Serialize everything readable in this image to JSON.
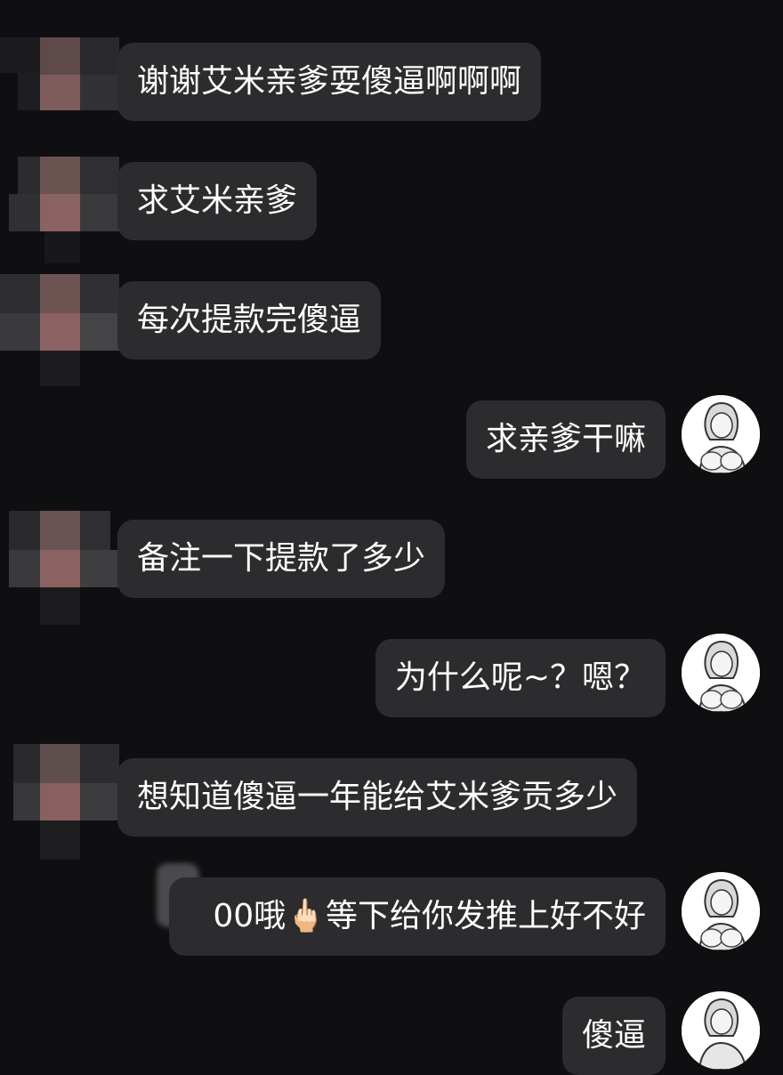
{
  "messages": [
    {
      "side": "in",
      "text": "谢谢艾米亲爹耍傻逼啊啊啊"
    },
    {
      "side": "in",
      "text": "求艾米亲爹"
    },
    {
      "side": "in",
      "text": "每次提款完傻逼"
    },
    {
      "side": "out",
      "text": "求亲爹干嘛"
    },
    {
      "side": "in",
      "text": "备注一下提款了多少"
    },
    {
      "side": "out",
      "text": "为什么呢~？嗯？"
    },
    {
      "side": "in",
      "text": "想知道傻逼一年能给艾米爹贡多少"
    },
    {
      "side": "out",
      "text": "00哦🖕🏻等下给你发推上好不好"
    },
    {
      "side": "out",
      "text": "傻逼"
    }
  ],
  "colors": {
    "background": "#0f0f11",
    "bubble": "#2c2c2e",
    "text": "#ffffff"
  },
  "icons": {
    "incoming_avatar": "pixelated-avatar-icon",
    "outgoing_avatar": "anime-girl-avatar-icon"
  }
}
